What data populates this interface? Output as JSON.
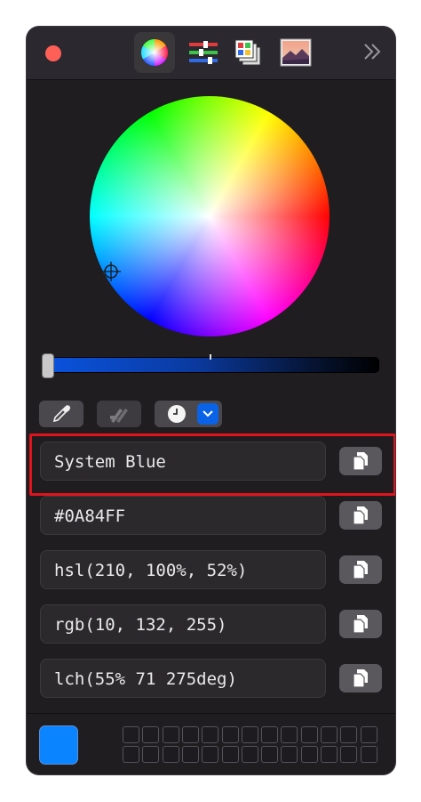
{
  "window": {
    "close_color": "#fe5f57",
    "tabs": [
      {
        "name": "color-wheel-tab",
        "icon": "color-wheel-icon",
        "active": true
      },
      {
        "name": "sliders-tab",
        "icon": "sliders-icon",
        "active": false
      },
      {
        "name": "palettes-tab",
        "icon": "palettes-icon",
        "active": false
      },
      {
        "name": "image-palettes-tab",
        "icon": "image-palette-icon",
        "active": false
      }
    ],
    "expand_icon": "double-chevron-right-icon"
  },
  "color_wheel": {
    "brightness_level": 0.0
  },
  "tools": {
    "eyedropper_icon": "eyedropper-icon",
    "pencil_icon": "pencils-icon",
    "history_icon": "clock-icon"
  },
  "formats": [
    {
      "value": "System Blue",
      "highlighted": true
    },
    {
      "value": "#0A84FF",
      "highlighted": false
    },
    {
      "value": "hsl(210, 100%, 52%)",
      "highlighted": false
    },
    {
      "value": "rgb(10, 132, 255)",
      "highlighted": false
    },
    {
      "value": "lch(55% 71 275deg)",
      "highlighted": false
    }
  ],
  "current_swatch_color": "#0A84FF",
  "highlight_color": "#e0141c"
}
